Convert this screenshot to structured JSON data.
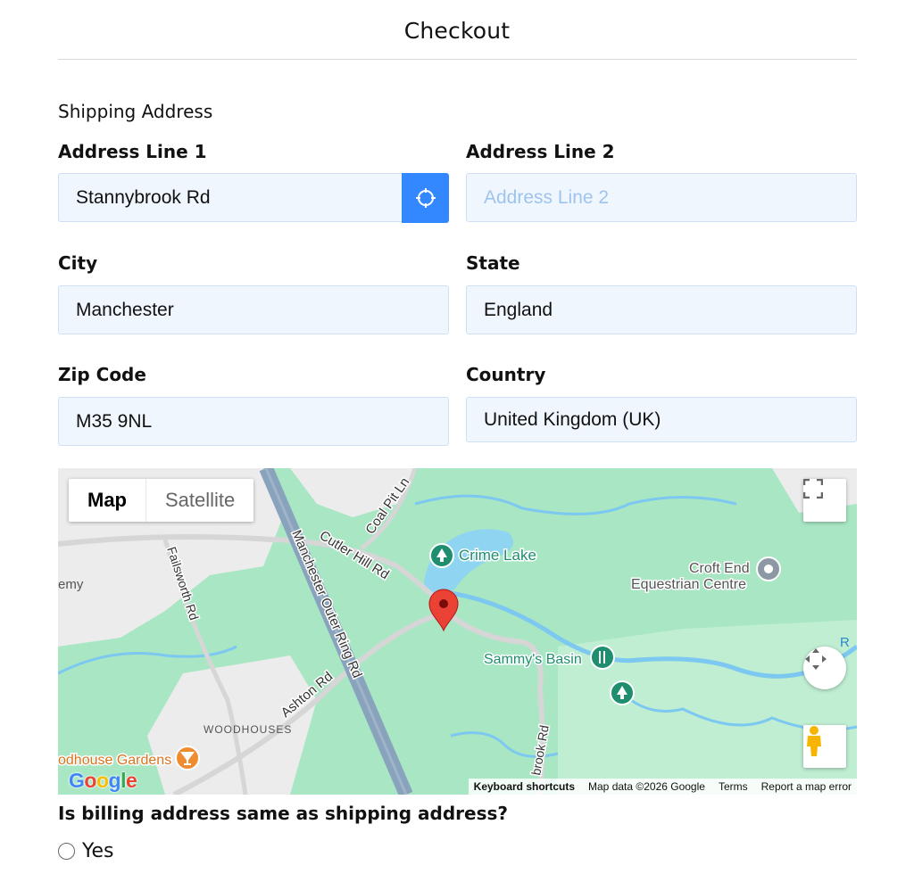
{
  "page": {
    "title": "Checkout"
  },
  "shipping": {
    "heading": "Shipping Address",
    "address1": {
      "label": "Address Line 1",
      "value": "Stannybrook Rd"
    },
    "address2": {
      "label": "Address Line 2",
      "value": "",
      "placeholder": "Address Line 2"
    },
    "city": {
      "label": "City",
      "value": "Manchester"
    },
    "state": {
      "label": "State",
      "value": "England"
    },
    "zip": {
      "label": "Zip Code",
      "value": "M35 9NL"
    },
    "country": {
      "label": "Country",
      "value": "United Kingdom (UK)"
    }
  },
  "map": {
    "type_map": "Map",
    "type_satellite": "Satellite",
    "labels": {
      "coal_pit_ln": "Coal Pit Ln",
      "cutler_hill_rd": "Cutler Hill Rd",
      "manchester_outer_ring_rd": "Manchester Outer Ring Rd",
      "failsworth_rd": "Failsworth Rd",
      "emy": "emy",
      "crime_lake": "Crime Lake",
      "croft_end_1": "Croft End",
      "croft_end_2": "Equestrian Centre",
      "sammys_basin": "Sammy's Basin",
      "ashton_rd": "Ashton Rd",
      "woodhouses": "WOODHOUSES",
      "brook_rd": "brook Rd",
      "woodhouse_gardens": "odhouse Gardens",
      "edge_r": "R"
    },
    "logo": "Google",
    "footer": {
      "keyboard": "Keyboard shortcuts",
      "data": "Map data ©2026 Google",
      "terms": "Terms",
      "report": "Report a map error"
    }
  },
  "billing": {
    "question": "Is billing address same as shipping address?",
    "option_yes": "Yes"
  }
}
